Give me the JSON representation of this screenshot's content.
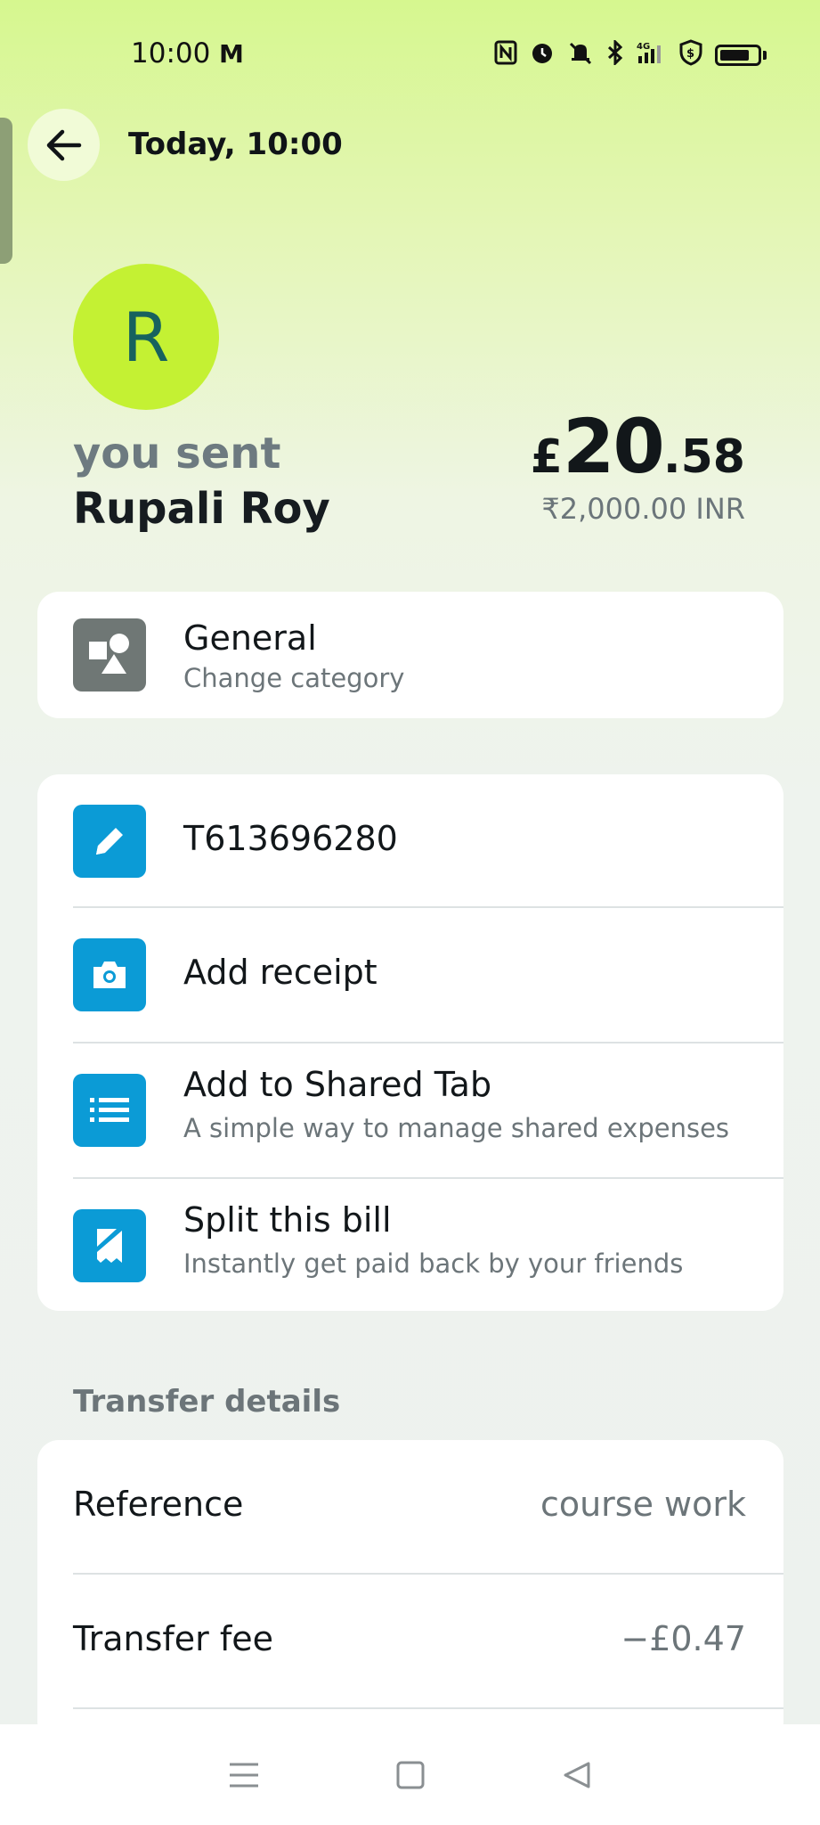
{
  "status_bar": {
    "time": "10:00",
    "carrier_icon": "M",
    "network": "4G"
  },
  "header": {
    "title": "Today, 10:00"
  },
  "recipient": {
    "initial": "R",
    "prefix": "you sent",
    "name": "Rupali Roy"
  },
  "amount": {
    "currency_symbol": "£",
    "whole": "20",
    "decimal": ".58",
    "converted": "₹2,000.00 INR"
  },
  "category": {
    "title": "General",
    "subtitle": "Change category"
  },
  "actions": [
    {
      "title": "T613696280",
      "subtitle": "",
      "icon": "pencil-icon"
    },
    {
      "title": "Add receipt",
      "subtitle": "",
      "icon": "camera-icon"
    },
    {
      "title": "Add to Shared Tab",
      "subtitle": "A simple way to manage shared expenses",
      "icon": "list-icon"
    },
    {
      "title": "Split this bill",
      "subtitle": "Instantly get paid back by your friends",
      "icon": "receipt-split-icon"
    }
  ],
  "transfer_details": {
    "section_title": "Transfer details",
    "rows": [
      {
        "label": "Reference",
        "value": "course work"
      },
      {
        "label": "Transfer fee",
        "value": "−£0.47"
      }
    ]
  },
  "colors": {
    "accent_blue": "#0b9bd6",
    "avatar_bg": "#c4f133",
    "avatar_text": "#17625e"
  }
}
